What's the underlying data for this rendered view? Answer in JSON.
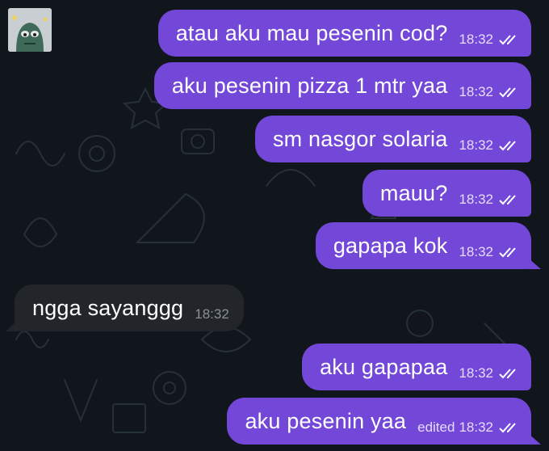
{
  "theme": {
    "background": "#11161c",
    "outgoing_bubble": "#7347d8",
    "incoming_bubble": "#222529",
    "text": "#ffffff"
  },
  "chat": {
    "avatar_icon": "sticker-avatar-icon",
    "messages": [
      {
        "direction": "outgoing",
        "text": "atau aku mau pesenin cod?",
        "time": "18:32",
        "status": "read",
        "status_icon": "double-check-icon"
      },
      {
        "direction": "outgoing",
        "text": "aku pesenin pizza 1 mtr yaa",
        "time": "18:32",
        "status": "read",
        "status_icon": "double-check-icon"
      },
      {
        "direction": "outgoing",
        "text": "sm nasgor solaria",
        "time": "18:32",
        "status": "read",
        "status_icon": "double-check-icon"
      },
      {
        "direction": "outgoing",
        "text": "mauu?",
        "time": "18:32",
        "status": "read",
        "status_icon": "double-check-icon"
      },
      {
        "direction": "outgoing",
        "text": "gapapa kok",
        "time": "18:32",
        "status": "read",
        "status_icon": "double-check-icon"
      },
      {
        "direction": "incoming",
        "text": "ngga sayanggg",
        "time": "18:32"
      },
      {
        "direction": "outgoing",
        "text": "aku gapapaa",
        "time": "18:32",
        "status": "read",
        "status_icon": "double-check-icon"
      },
      {
        "direction": "outgoing",
        "text": "aku pesenin yaa",
        "edited_label": "edited",
        "time": "18:32",
        "status": "read",
        "status_icon": "double-check-icon"
      }
    ]
  }
}
